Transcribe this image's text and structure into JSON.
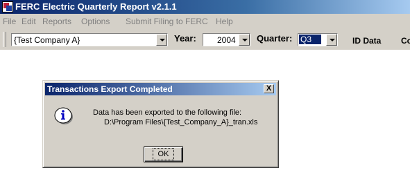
{
  "window": {
    "title": "FERC Electric Quarterly Report v2.1.1"
  },
  "menu": [
    "File",
    "Edit",
    "Reports",
    "Options",
    "Submit Filing to FERC",
    "Help"
  ],
  "toolbar": {
    "company_value": "{Test Company A}",
    "year_label": "Year:",
    "year_value": "2004",
    "quarter_label": "Quarter:",
    "quarter_value": "Q3",
    "id_data_label": "ID Data",
    "cut_label": "Co"
  },
  "dialog": {
    "title": "Transactions Export Completed",
    "close_label": "X",
    "message_line1": "Data has been exported to the following file:",
    "message_line2": "D:\\Program Files\\{Test_Company_A}_tran.xls",
    "ok_label": "OK",
    "icon": "information-icon"
  },
  "colors": {
    "titlebar": "#0a246a",
    "face": "#d4d0c8",
    "selection": "#0a246a"
  }
}
